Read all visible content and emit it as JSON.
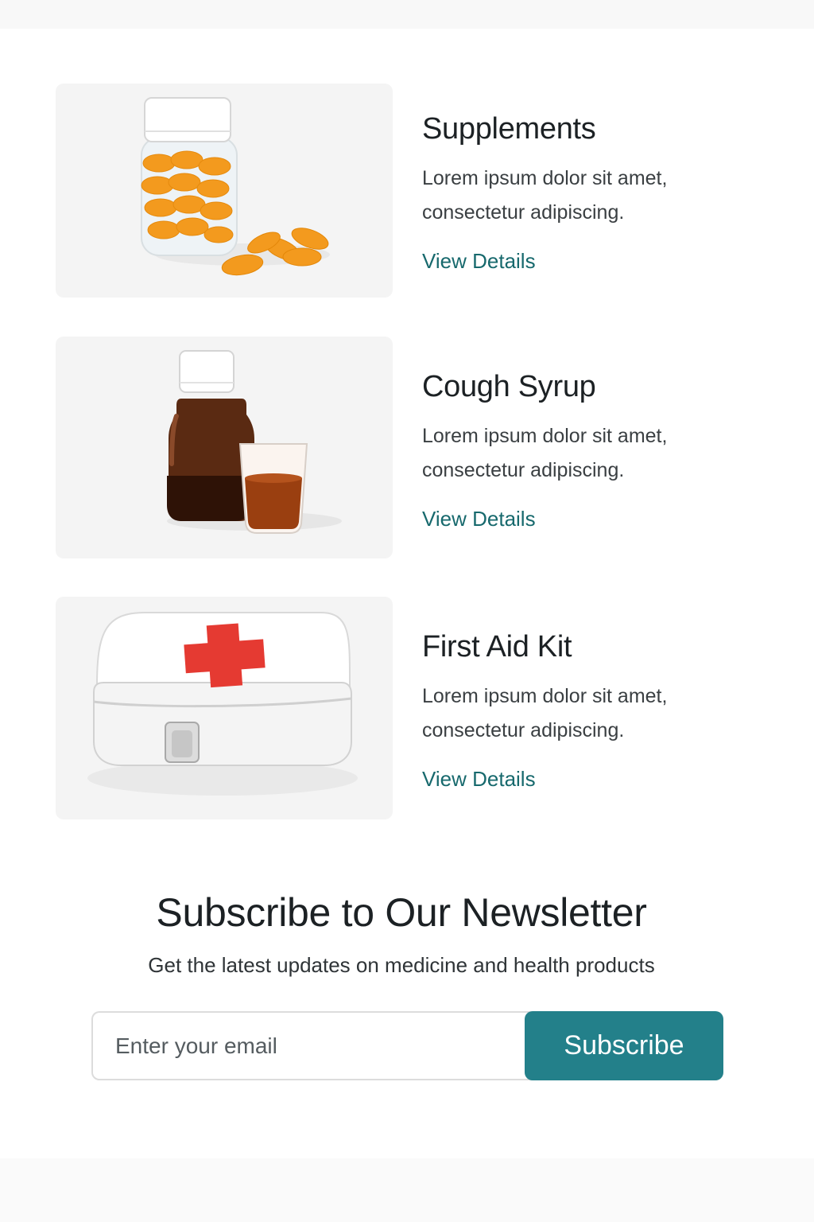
{
  "products": [
    {
      "name": "Supplements",
      "description_line1": "Lorem ipsum dolor sit amet,",
      "description_line2": "consectetur adipiscing.",
      "link": "View Details",
      "image": "supplement-capsule-jar-image"
    },
    {
      "name": "Cough Syrup",
      "description_line1": "Lorem ipsum dolor sit amet,",
      "description_line2": "consectetur adipiscing.",
      "link": "View Details",
      "image": "cough-syrup-bottle-image"
    },
    {
      "name": "First Aid Kit",
      "description_line1": "Lorem ipsum dolor sit amet,",
      "description_line2": "consectetur adipiscing.",
      "link": "View Details",
      "image": "first-aid-kit-image"
    }
  ],
  "newsletter": {
    "title": "Subscribe to Our Newsletter",
    "subtitle": "Get the latest updates on medicine and health products",
    "email_placeholder": "Enter your email",
    "button_label": "Subscribe"
  },
  "colors": {
    "accent": "#23808a",
    "link": "#17696d",
    "heading": "#1c2124",
    "card_background": "#f4f4f4"
  }
}
